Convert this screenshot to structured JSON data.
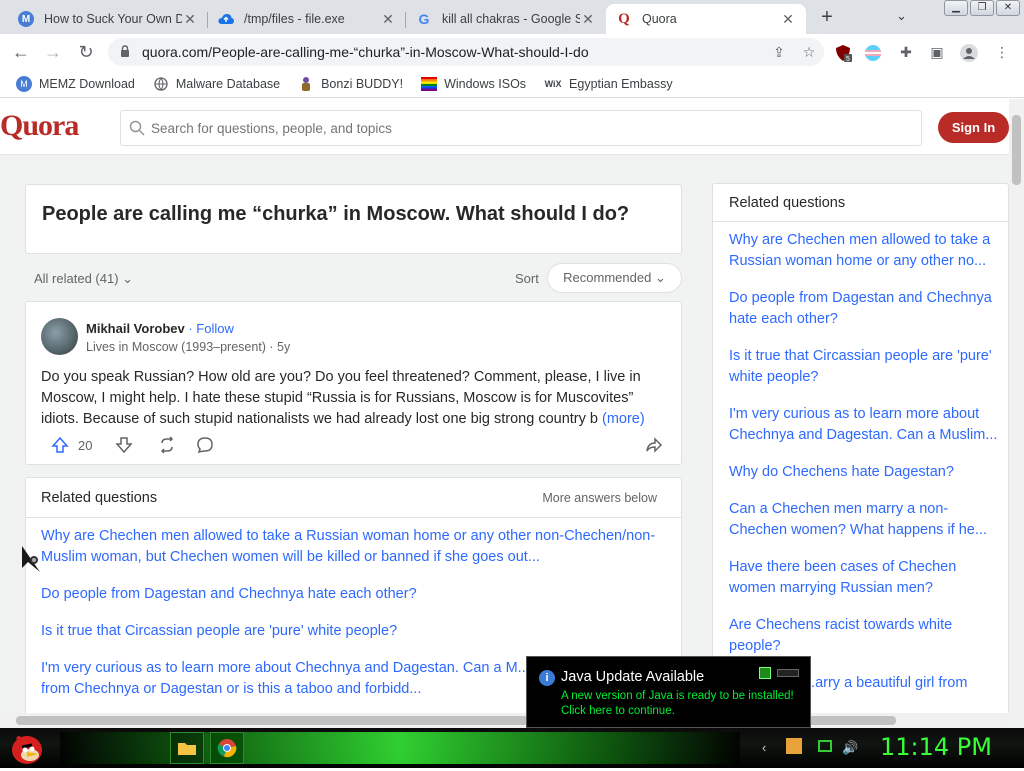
{
  "browser": {
    "tabs": [
      {
        "title": "How to Suck Your Own D",
        "favicon": "M"
      },
      {
        "title": "/tmp/files - file.exe",
        "favicon": "cloud"
      },
      {
        "title": "kill all chakras - Google S",
        "favicon": "G"
      },
      {
        "title": "Quora",
        "favicon": "Q"
      }
    ],
    "new_tab": "+",
    "url": "quora.com/People-are-calling-me-“churka”-in-Moscow-What-should-I-do",
    "extension_badge": "5",
    "bookmarks": [
      {
        "label": "MEMZ Download"
      },
      {
        "label": "Malware Database"
      },
      {
        "label": "Bonzi BUDDY!"
      },
      {
        "label": "Windows ISOs"
      },
      {
        "label": "Egyptian Embassy",
        "icon_text": "WiX"
      }
    ]
  },
  "quora": {
    "logo": "Quora",
    "search_placeholder": "Search for questions, people, and topics",
    "signin": "Sign In",
    "question": "People are calling me “churka” in Moscow. What should I do?",
    "all_related": "All related (41)",
    "sort_label": "Sort",
    "sort_value": "Recommended",
    "answer": {
      "author": "Mikhail Vorobev",
      "follow": "· Follow",
      "meta": "Lives in Moscow (1993–present) · 5y",
      "text": "Do you speak Russian? How old are you? Do you feel threatened? Comment, please, I live in Moscow, I might help. I hate these stupid “Russia is for Russians, Moscow is for Muscovites” idiots. Because of such stupid nationalists we had already lost one big strong country b",
      "more": "(more)",
      "upvotes": "20"
    },
    "related_main": {
      "heading": "Related questions",
      "more_answers": "More answers below",
      "questions": [
        "Why are Chechen men allowed to take a Russian woman home or any other non-Chechen/non-Muslim woman, but Chechen women will be killed or banned if she goes out...",
        "Do people from Dagestan and Chechnya hate each other?",
        "Is it true that Circassian people are 'pure' white people?",
        "I'm very curious as to learn more about Chechnya and Dagestan. Can a M... marry a woman from Chechnya or Dagestan or is this a taboo and forbidd..."
      ]
    },
    "related_side": {
      "heading": "Related questions",
      "questions": [
        "Why are Chechen men allowed to take a Russian woman home or any other no...",
        "Do people from Dagestan and Chechnya hate each other?",
        "Is it true that Circassian people are 'pure' white people?",
        "I'm very curious as to learn more about Chechnya and Dagestan. Can a Muslim...",
        "Why do Chechens hate Dagestan?",
        "Can a Chechen men marry a non-Chechen women? What happens if he...",
        "Have there been cases of Chechen women marrying Russian men?",
        "Are Chechens racist towards white people?",
        "...arry a beautiful girl from"
      ]
    }
  },
  "java_popup": {
    "title": "Java Update Available",
    "line1": "A new version of Java is ready to be installed!",
    "line2": "Click here to continue."
  },
  "taskbar": {
    "clock": "11:14 PM"
  },
  "colors": {
    "quora_red": "#b92b27",
    "link_blue": "#2e69ff",
    "java_green": "#00ee33",
    "clock_green": "#39ff39"
  }
}
